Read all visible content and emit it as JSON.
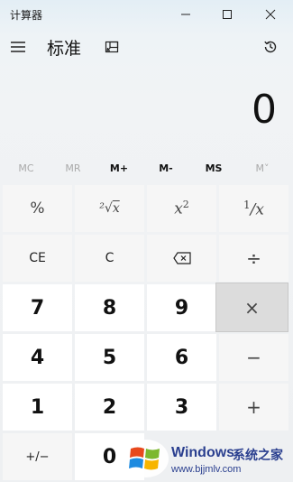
{
  "app": {
    "title": "计算器"
  },
  "header": {
    "mode": "标准"
  },
  "display": {
    "value": "0"
  },
  "memory": [
    "MC",
    "MR",
    "M+",
    "M-",
    "MS",
    "M˅"
  ],
  "memory_enabled": [
    false,
    false,
    true,
    true,
    true,
    false
  ],
  "keys": {
    "percent": "%",
    "ce": "CE",
    "c": "C",
    "divide": "÷",
    "multiply": "×",
    "minus": "−",
    "plus": "+",
    "negate": "+/−",
    "d7": "7",
    "d8": "8",
    "d9": "9",
    "d4": "4",
    "d5": "5",
    "d6": "6",
    "d1": "1",
    "d2": "2",
    "d3": "3",
    "d0": "0"
  },
  "watermark": {
    "brand": "Windows",
    "cn": "系统之家",
    "url": "www.bjjmlv.com"
  },
  "icons": {
    "menu": "hamburger-icon",
    "keep_on_top": "keep-on-top-icon",
    "history": "history-icon",
    "backspace": "backspace-icon"
  },
  "colors": {
    "window_bg": "#f1f3f5",
    "number_key": "#ffffff",
    "op_key": "#f6f6f6",
    "active_key": "#dcdcdc",
    "watermark": "#2a3f8f"
  }
}
